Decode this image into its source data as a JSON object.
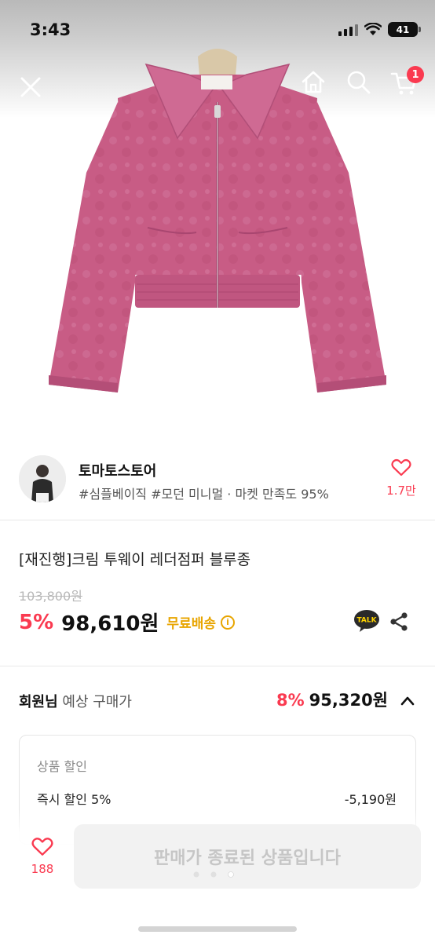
{
  "status_bar": {
    "time": "3:43",
    "battery": "41"
  },
  "nav": {
    "cart_count": "1"
  },
  "seller": {
    "name": "토마토스토어",
    "tags": "#심플베이직 #모던 미니멀 · 마켓 만족도 95%",
    "like_count": "1.7만"
  },
  "product": {
    "title": "[재진행]크림 투웨이 레더점퍼 블루종",
    "original_price": "103,800원",
    "discount_rate": "5%",
    "price": "98,610원",
    "free_shipping": "무료배송",
    "talk_label": "TALK"
  },
  "member_price": {
    "label_bold": "회원님",
    "label_rest": " 예상 구매가",
    "discount_rate": "8%",
    "price": "95,320원"
  },
  "discount_breakdown": {
    "title": "상품 할인",
    "lines": [
      {
        "label": "즉시 할인 5%",
        "value": "-5,190원"
      }
    ]
  },
  "bottom_bar": {
    "like_count": "188",
    "action_label": "판매가 종료된 상품입니다"
  },
  "carousel": {
    "total": 3,
    "active": 3
  },
  "colors": {
    "accent": "#fa3a50",
    "free_shipping": "#e8a500",
    "jacket": "#c95c86"
  }
}
